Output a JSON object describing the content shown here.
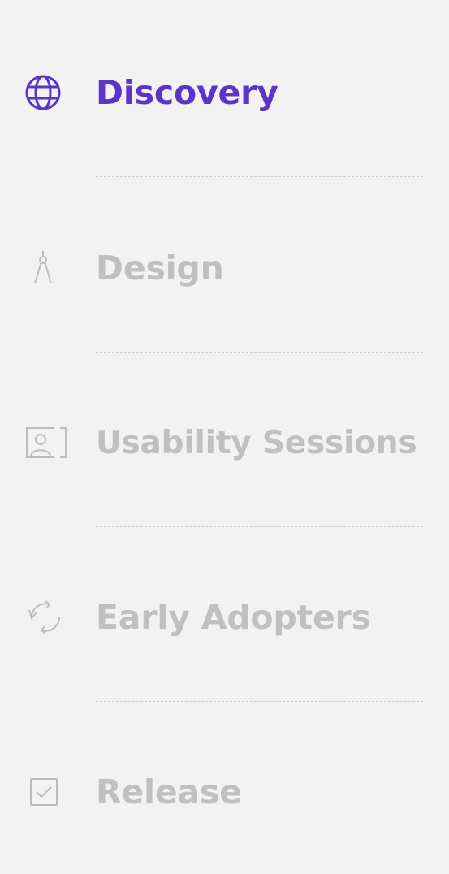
{
  "colors": {
    "background": "#f2f2f2",
    "active": "#5b35c9",
    "inactive": "#c0c0c0",
    "separator": "#cfcfcf"
  },
  "nav": {
    "items": [
      {
        "label": "Discovery",
        "icon": "globe-icon",
        "state": "active"
      },
      {
        "label": "Design",
        "icon": "compass-icon",
        "state": "inactive"
      },
      {
        "label": "Usability Sessions",
        "icon": "user-card-icon",
        "state": "inactive"
      },
      {
        "label": "Early Adopters",
        "icon": "refresh-icon",
        "state": "inactive"
      },
      {
        "label": "Release",
        "icon": "checkbox-icon",
        "state": "inactive"
      }
    ]
  }
}
